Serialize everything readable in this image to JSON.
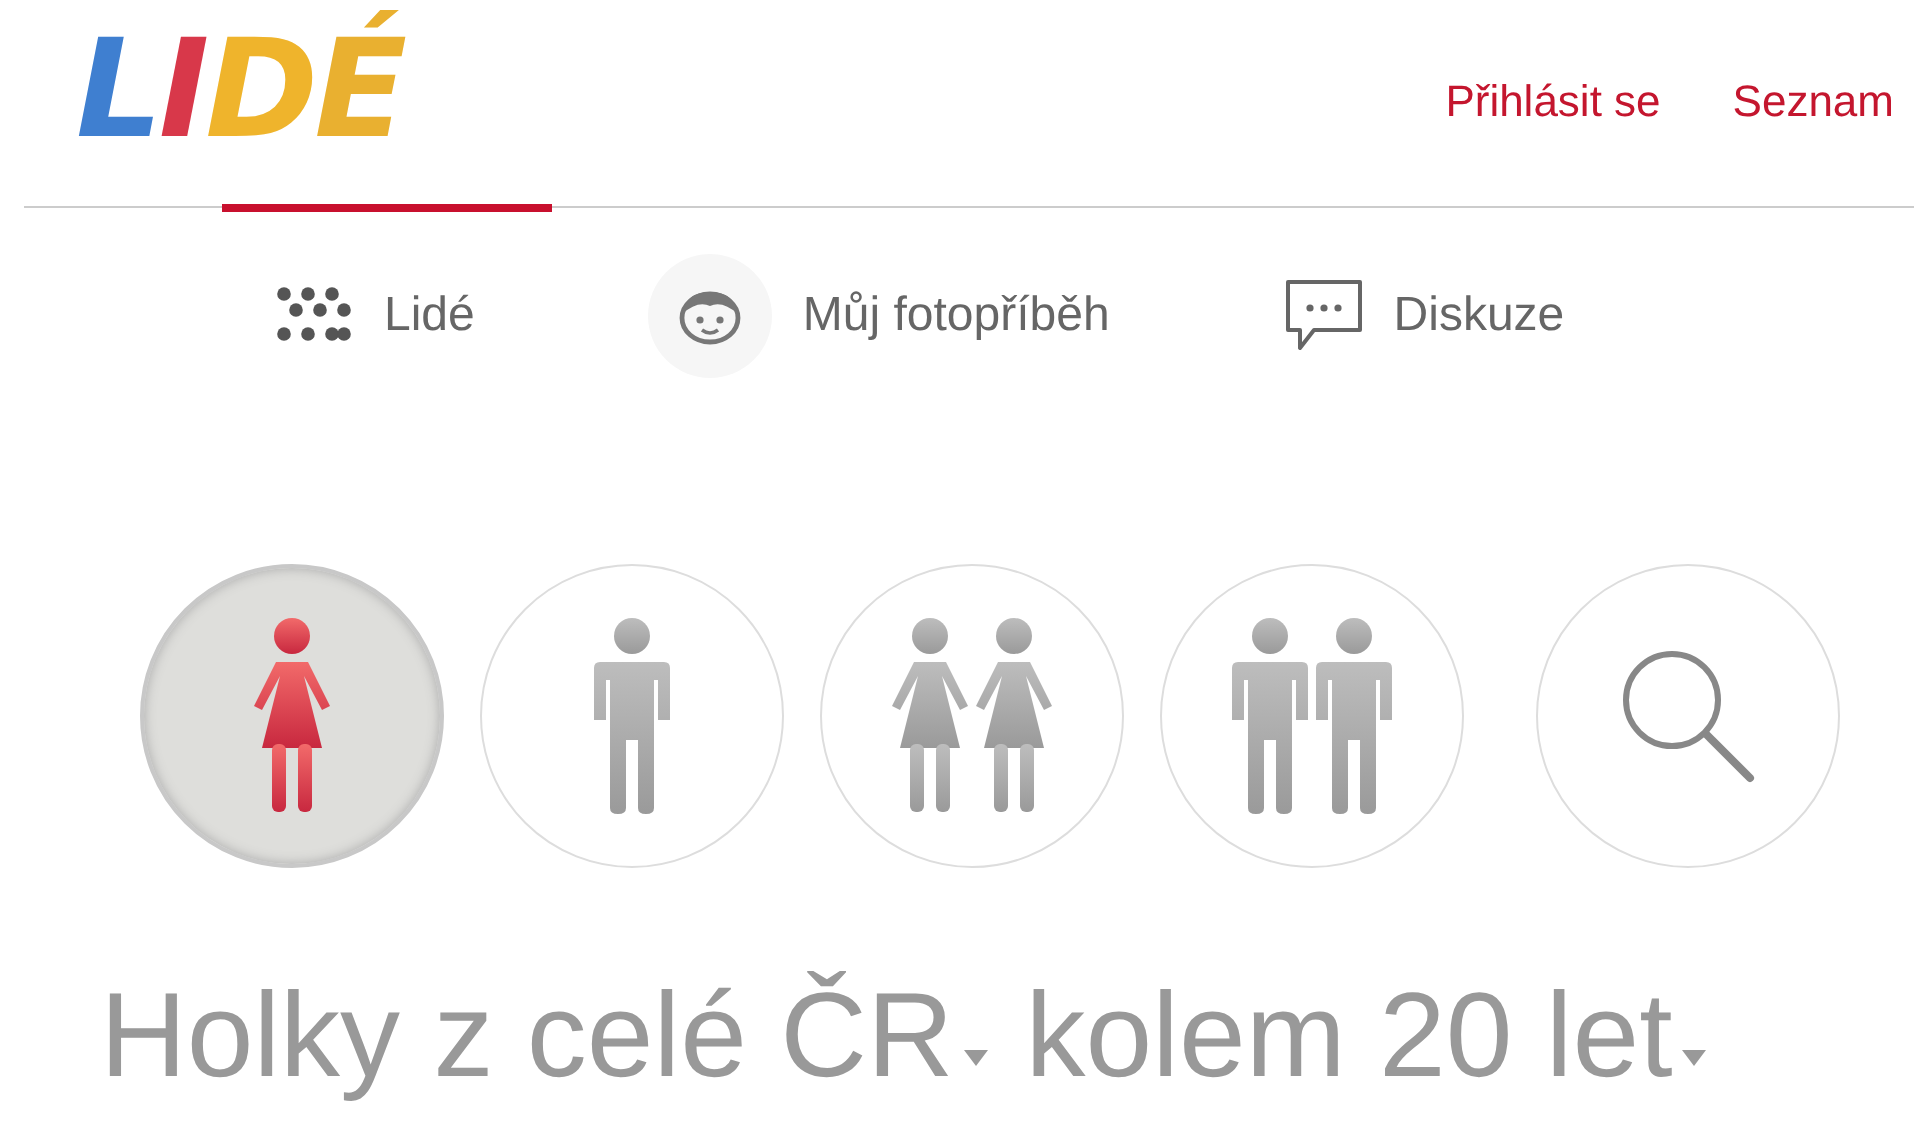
{
  "logo": {
    "text": "LIDÉ"
  },
  "header_links": [
    "Přihlásit se",
    "Seznam"
  ],
  "nav": [
    {
      "kind": "dots",
      "label": "Lidé"
    },
    {
      "kind": "face",
      "label": "Můj fotopříběh"
    },
    {
      "kind": "chat",
      "label": "Diskuze"
    }
  ],
  "filters": [
    {
      "kind": "woman",
      "selected": true
    },
    {
      "kind": "man",
      "selected": false
    },
    {
      "kind": "two-women",
      "selected": false
    },
    {
      "kind": "two-men",
      "selected": false
    },
    {
      "kind": "search",
      "selected": false
    }
  ],
  "headline": [
    {
      "label": "Holky z celé ČR"
    },
    {
      "label": "kolem 20 let"
    }
  ]
}
